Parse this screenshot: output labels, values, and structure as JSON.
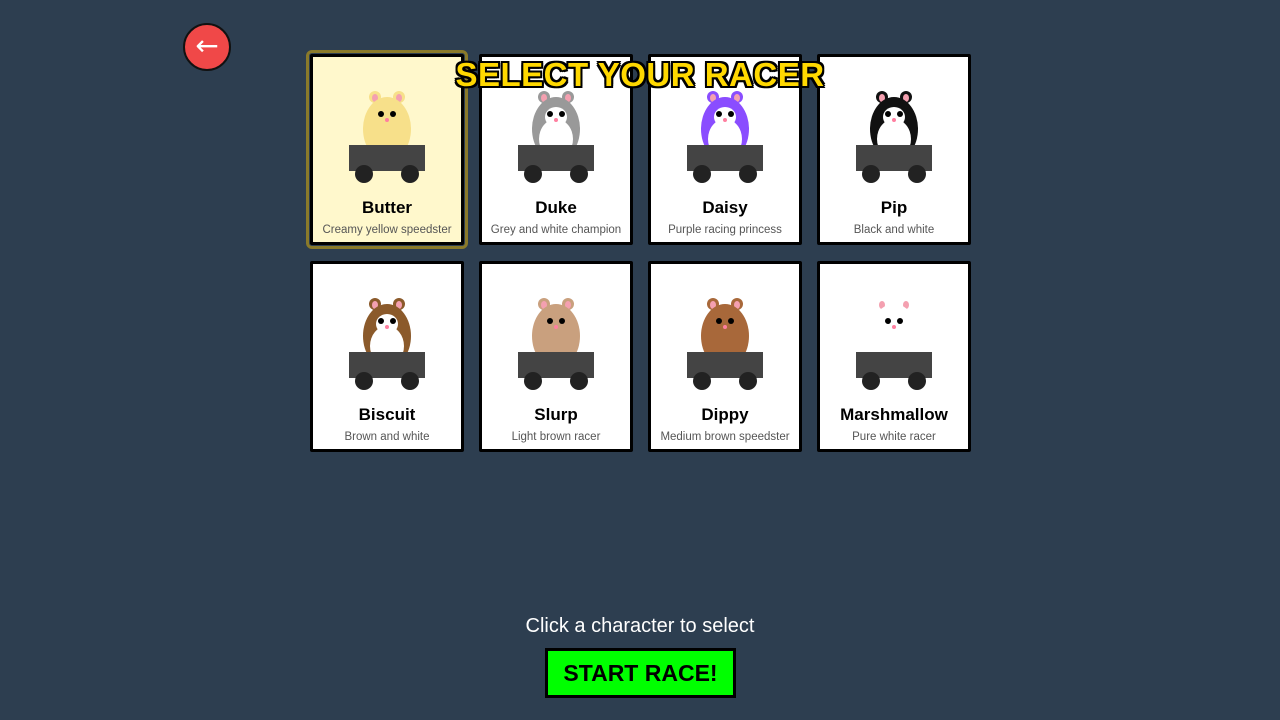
{
  "back_button": {
    "label": "←",
    "icon": "back-arrow-icon"
  },
  "title": "SELECT YOUR RACER",
  "racers": [
    {
      "name": "Butter",
      "description": "Creamy yellow speedster",
      "body_color": "#f7e08a",
      "belly_color": "#f7e08a",
      "face_color": "#f7e08a",
      "selected": true
    },
    {
      "name": "Duke",
      "description": "Grey and white champion",
      "body_color": "#999999",
      "belly_color": "#ffffff",
      "face_color": "#ffffff",
      "selected": false
    },
    {
      "name": "Daisy",
      "description": "Purple racing princess",
      "body_color": "#8a4dff",
      "belly_color": "#ffffff",
      "face_color": "#ffffff",
      "selected": false
    },
    {
      "name": "Pip",
      "description": "Black and white",
      "body_color": "#111111",
      "belly_color": "#ffffff",
      "face_color": "#ffffff",
      "selected": false
    },
    {
      "name": "Biscuit",
      "description": "Brown and white",
      "body_color": "#8b5a2b",
      "belly_color": "#ffffff",
      "face_color": "#ffffff",
      "selected": false
    },
    {
      "name": "Slurp",
      "description": "Light brown racer",
      "body_color": "#c9a07e",
      "belly_color": "#c9a07e",
      "face_color": "#c9a07e",
      "selected": false
    },
    {
      "name": "Dippy",
      "description": "Medium brown speedster",
      "body_color": "#a8683a",
      "belly_color": "#a8683a",
      "face_color": "#a8683a",
      "selected": false
    },
    {
      "name": "Marshmallow",
      "description": "Pure white racer",
      "body_color": "#ffffff",
      "belly_color": "#ffffff",
      "face_color": "#ffffff",
      "selected": false
    }
  ],
  "colors": {
    "background": "#2d3e50",
    "kart": "#444444",
    "wheel": "#222222",
    "ear_inner": "#f4a0b0",
    "nose": "#ff7fa0",
    "title": "#ffd800",
    "start_button": "#00ff00"
  },
  "hint": "Click a character to select",
  "start_button": {
    "label": "START RACE!"
  }
}
